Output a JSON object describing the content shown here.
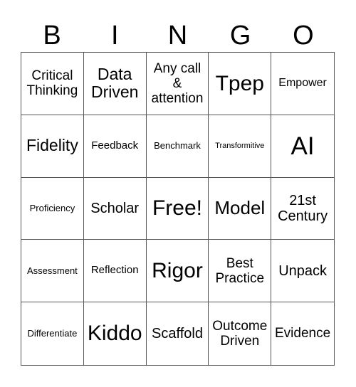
{
  "header": [
    "B",
    "I",
    "N",
    "G",
    "O"
  ],
  "cells": [
    "Critical Thinking",
    "Data Driven",
    "Any call & attention",
    "Tpep",
    "Empower",
    "Fidelity",
    "Feedback",
    "Benchmark",
    "Transformitive",
    "AI",
    "Proficiency",
    "Scholar",
    "Free!",
    "Model",
    "21st Century",
    "Assessment",
    "Reflection",
    "Rigor",
    "Best Practice",
    "Unpack",
    "Differentiate",
    "Kiddo",
    "Scaffold",
    "Outcome Driven",
    "Evidence"
  ]
}
